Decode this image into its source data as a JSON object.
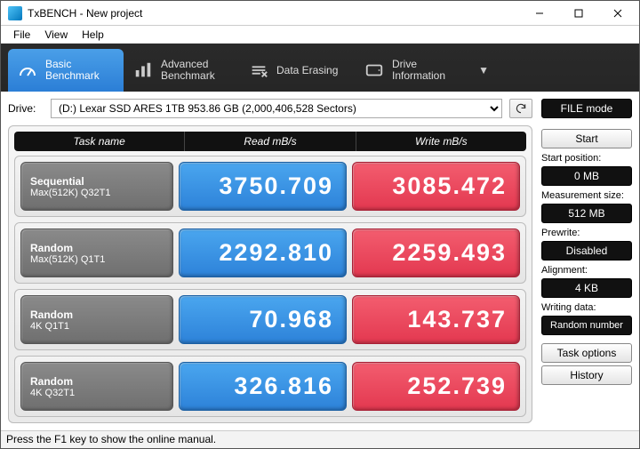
{
  "window": {
    "title": "TxBENCH - New project"
  },
  "menu": {
    "file": "File",
    "view": "View",
    "help": "Help"
  },
  "tabs": {
    "basic": "Basic\nBenchmark",
    "advanced": "Advanced\nBenchmark",
    "erase": "Data Erasing",
    "info": "Drive\nInformation"
  },
  "drive": {
    "label": "Drive:",
    "value": "(D:) Lexar SSD ARES 1TB  953.86 GB (2,000,406,528 Sectors)"
  },
  "filemode": "FILE mode",
  "headers": {
    "task": "Task name",
    "read": "Read mB/s",
    "write": "Write mB/s"
  },
  "rows": [
    {
      "name1": "Sequential",
      "name2": "Max(512K) Q32T1",
      "read": "3750.709",
      "write": "3085.472"
    },
    {
      "name1": "Random",
      "name2": "Max(512K) Q1T1",
      "read": "2292.810",
      "write": "2259.493"
    },
    {
      "name1": "Random",
      "name2": "4K Q1T1",
      "read": "70.968",
      "write": "143.737"
    },
    {
      "name1": "Random",
      "name2": "4K Q32T1",
      "read": "326.816",
      "write": "252.739"
    }
  ],
  "side": {
    "start": "Start",
    "startpos_lbl": "Start position:",
    "startpos": "0 MB",
    "measure_lbl": "Measurement size:",
    "measure": "512 MB",
    "prewrite_lbl": "Prewrite:",
    "prewrite": "Disabled",
    "align_lbl": "Alignment:",
    "align": "4 KB",
    "writing_lbl": "Writing data:",
    "writing": "Random number",
    "taskopt": "Task options",
    "history": "History"
  },
  "status": "Press the F1 key to show the online manual."
}
